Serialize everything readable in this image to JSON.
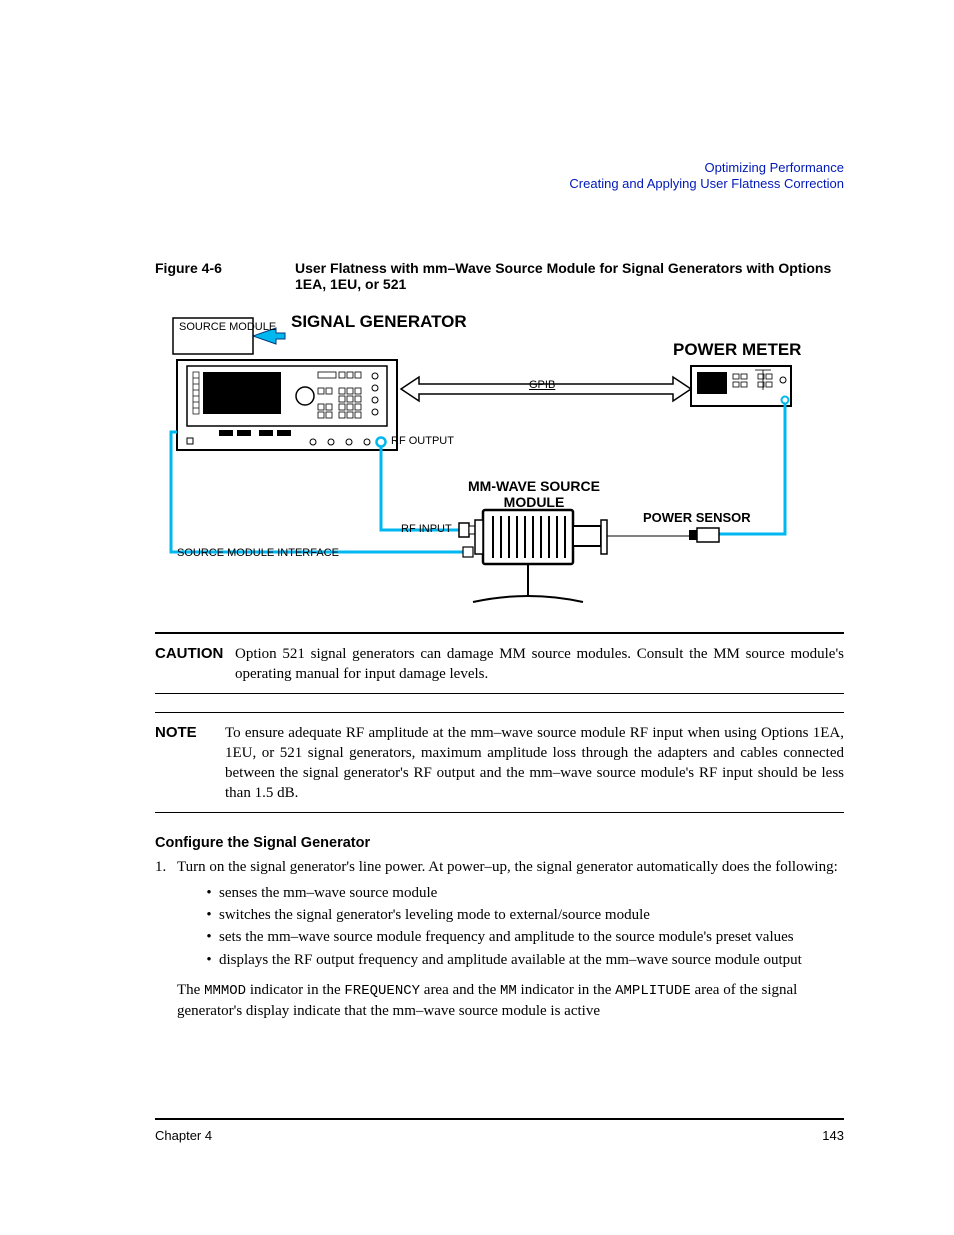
{
  "header": {
    "line1": "Optimizing Performance",
    "line2": "Creating and Applying User Flatness Correction"
  },
  "figure": {
    "label": "Figure 4-6",
    "caption": "User Flatness with mm–Wave Source Module for Signal Generators with Options 1EA, 1EU, or 521"
  },
  "diagram": {
    "source_module_label": "SOURCE MODULE",
    "signal_generator_label": "SIGNAL GENERATOR",
    "power_meter_label": "POWER METER",
    "gpib_label": "GPIB",
    "rf_output_label": "RF OUTPUT",
    "mm_wave_label_line1": "MM-WAVE SOURCE",
    "mm_wave_label_line2": "MODULE",
    "rf_input_label": "RF INPUT",
    "power_sensor_label": "POWER SENSOR",
    "source_module_interface_label": "SOURCE MODULE INTERFACE"
  },
  "caution": {
    "label": "CAUTION",
    "text": "Option 521 signal generators can damage MM source modules. Consult the MM source module's operating manual for input damage levels."
  },
  "note": {
    "label": "NOTE",
    "text": "To ensure adequate RF amplitude at the mm–wave source module RF input when using Options 1EA, 1EU, or 521 signal generators, maximum amplitude loss through the adapters and cables connected between the signal generator's RF output and the mm–wave source module's RF input should be less than 1.5 dB."
  },
  "section": {
    "heading": "Configure the Signal Generator",
    "step1_num": "1.",
    "step1_text": "Turn on the signal generator's line power. At power–up, the signal generator automatically does the following:",
    "bullets": [
      "senses the mm–wave source module",
      "switches the signal generator's leveling mode to external/source module",
      "sets the mm–wave source module frequency and amplitude to the source module's preset values",
      "displays the RF output frequency and amplitude available at the mm–wave source module output"
    ],
    "indicator_prefix": "The ",
    "indicator_mmmod": "MMMOD",
    "indicator_mid1": " indicator in the ",
    "indicator_frequency": "FREQUENCY",
    "indicator_mid2": " area and the ",
    "indicator_mm": "MM",
    "indicator_mid3": " indicator in the ",
    "indicator_amplitude": "AMPLITUDE",
    "indicator_suffix": " area of the signal generator's display indicate that the mm–wave source module is active"
  },
  "footer": {
    "left": "Chapter 4",
    "right": "143"
  }
}
